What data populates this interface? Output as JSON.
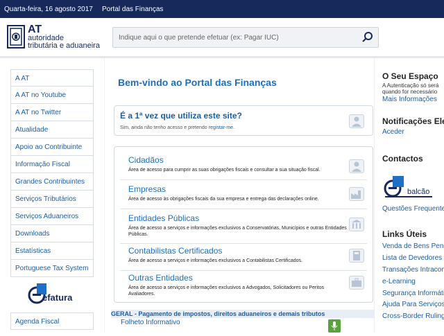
{
  "topbar": {
    "date": "Quarta-feira, 16 agosto 2017",
    "portal": "Portal das Finanças"
  },
  "logo": {
    "line1": "AT",
    "line2": "autoridade",
    "line3": "tributária e aduaneira"
  },
  "search": {
    "placeholder": "Indique aqui o que pretende efetuar (ex: Pagar IUC)"
  },
  "sidebar": {
    "items": [
      {
        "label": "A AT"
      },
      {
        "label": "A AT no Youtube"
      },
      {
        "label": "A AT no Twitter"
      },
      {
        "label": "Atualidade"
      },
      {
        "label": "Apoio ao Contribuinte"
      },
      {
        "label": "Informação Fiscal"
      },
      {
        "label": "Grandes Contribuintes"
      },
      {
        "label": "Serviços Tributários"
      },
      {
        "label": "Serviços Aduaneiros"
      },
      {
        "label": "Downloads"
      },
      {
        "label": "Estatísticas"
      },
      {
        "label": "Portuguese Tax System"
      }
    ],
    "efatura": "efatura",
    "agenda": "Agenda Fiscal"
  },
  "main": {
    "welcome": "Bem-vindo ao Portal das Finanças",
    "first_time": {
      "question": "É a 1ª vez que utiliza este site?",
      "sub": "Sim, ainda não tenho acesso e pretendo ",
      "link": "registar-me",
      "end": "."
    },
    "cards": [
      {
        "title": "Cidadãos",
        "desc": "Área de acesso para cumprir as suas obrigações fiscais e consultar a sua situação fiscal."
      },
      {
        "title": "Empresas",
        "desc": "Área de acesso às obrigações fiscais da sua empresa e entrega das declarações online."
      },
      {
        "title": "Entidades Públicas",
        "desc": "Área de acesso a serviços e informações exclusivos a Conservatórias, Municípios e outras Entidades Públicas."
      },
      {
        "title": "Contabilistas Certificados",
        "desc": "Área de acesso a serviços e informações exclusivos a Contabilistas Certificados."
      },
      {
        "title": "Outras Entidades",
        "desc": "Área de acesso a serviços e informações exclusivos a Advogados, Solicitadores ou Peritos Avaliadores."
      }
    ],
    "geral": "GERAL - Pagamento de impostos, direitos aduaneiros e demais tributos",
    "folheto": "Folheto Informativo"
  },
  "right": {
    "espaco_title": "O Seu Espaço",
    "espaco_text1": "A Autenticação só será",
    "espaco_text2": "quando for necessário",
    "espaco_link": "Mais Informações",
    "notif_title": "Notificações Eletr",
    "notif_link": "Aceder",
    "contactos_title": "Contactos",
    "balcao": "balcão",
    "questoes": "Questões Frequentes",
    "links_title": "Links Úteis",
    "links": [
      {
        "label": "Venda de Bens Penho"
      },
      {
        "label": "Lista de Devedores"
      },
      {
        "label": "Transações Intracom"
      },
      {
        "label": "e-Learning"
      },
      {
        "label": "Segurança Informátic"
      },
      {
        "label": "Ajuda Para Serviços"
      },
      {
        "label": "Cross-Border Ruling ("
      }
    ]
  },
  "colors": {
    "topbar": "#17295a",
    "link": "#1a5da8",
    "title": "#1a6fc0",
    "mic": "#5aa23a"
  }
}
